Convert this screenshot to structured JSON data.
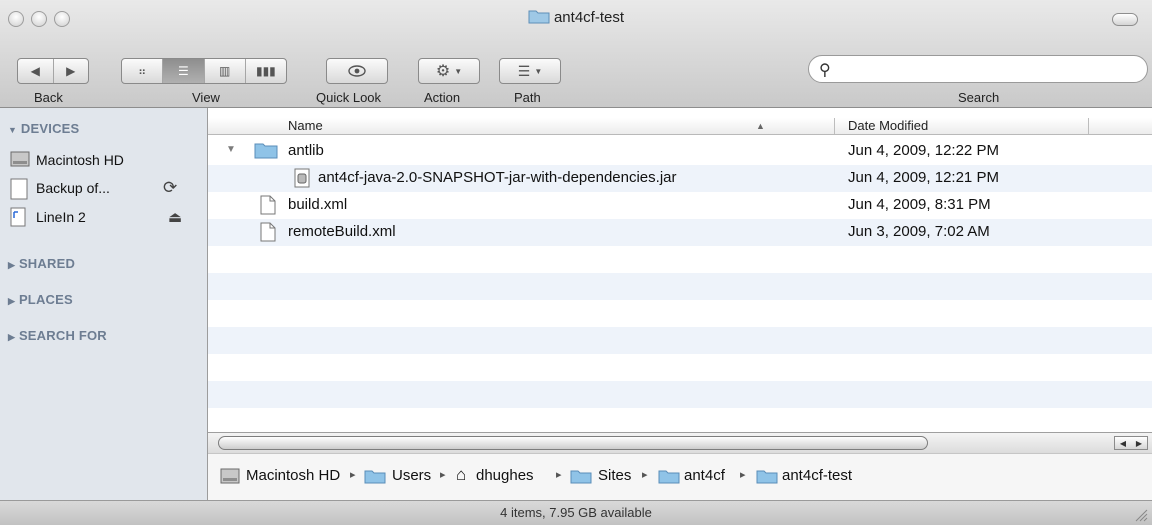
{
  "window": {
    "title": "ant4cf-test"
  },
  "toolbar": {
    "back_label": "Back",
    "view_label": "View",
    "quick_look_label": "Quick Look",
    "action_label": "Action",
    "path_label": "Path",
    "search_label": "Search",
    "search_value": ""
  },
  "icons": {
    "back": "chevron-left-icon",
    "forward": "chevron-right-icon",
    "icon_view": "grid-icon",
    "list_view": "list-icon",
    "column_view": "columns-icon",
    "coverflow_view": "coverflow-icon",
    "quick_look": "eye-icon",
    "action": "gear-icon",
    "path": "path-icon",
    "search": "search-icon"
  },
  "sidebar": {
    "devices_label": "DEVICES",
    "devices": [
      {
        "label": "Macintosh HD"
      },
      {
        "label": "Backup of..."
      },
      {
        "label": "LineIn 2"
      }
    ],
    "shared_label": "SHARED",
    "places_label": "PLACES",
    "search_for_label": "SEARCH FOR"
  },
  "columns": {
    "name": "Name",
    "date_modified": "Date Modified"
  },
  "files": [
    {
      "name": "antlib",
      "date": "Jun 4, 2009, 12:22 PM",
      "kind": "folder",
      "expanded": true
    },
    {
      "name": "ant4cf-java-2.0-SNAPSHOT-jar-with-dependencies.jar",
      "date": "Jun 4, 2009, 12:21 PM",
      "kind": "jar"
    },
    {
      "name": "build.xml",
      "date": "Jun 4, 2009, 8:31 PM",
      "kind": "document"
    },
    {
      "name": "remoteBuild.xml",
      "date": "Jun 3, 2009, 7:02 AM",
      "kind": "document"
    }
  ],
  "path": [
    {
      "label": "Macintosh HD"
    },
    {
      "label": "Users"
    },
    {
      "label": "dhughes"
    },
    {
      "label": "Sites"
    },
    {
      "label": "ant4cf"
    },
    {
      "label": "ant4cf-test"
    }
  ],
  "status": {
    "text": "4 items, 7.95 GB available"
  },
  "colors": {
    "sidebar_bg": "#e1e6ec",
    "sidebar_header": "#6d7d92",
    "row_alt": "#eef3fa",
    "folder_blue": "#7fb7de"
  }
}
